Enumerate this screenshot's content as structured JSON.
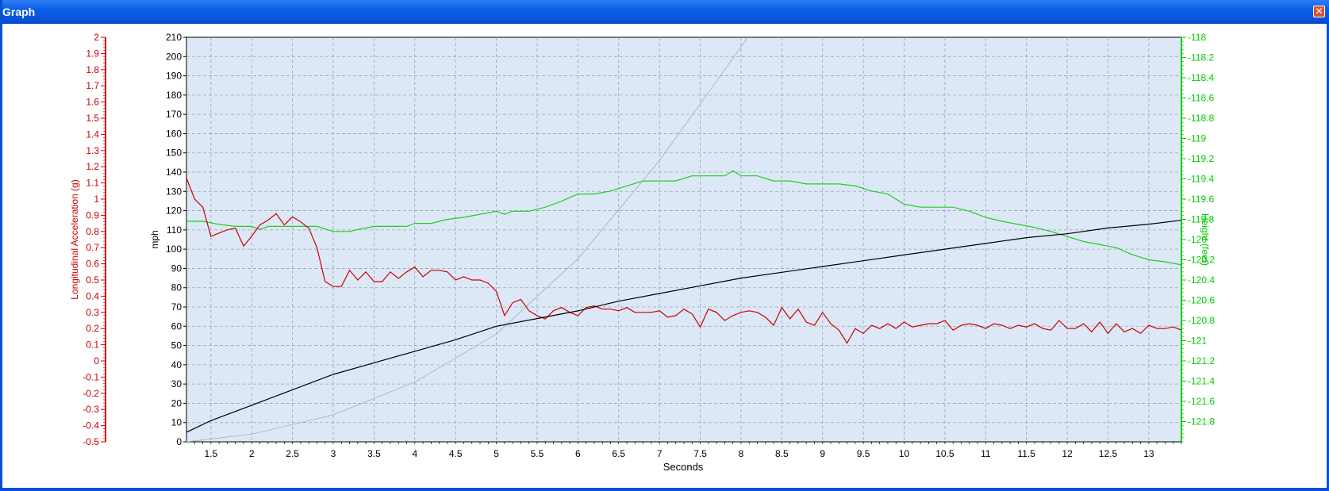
{
  "window": {
    "title": "Graph",
    "close_icon": "close-icon"
  },
  "colors": {
    "plot_bg": "#dde8f6",
    "grid": "#9aa4b2",
    "left_axis": "#cc0000",
    "right_axis": "#00cc00",
    "speed": "#000000",
    "accel": "#cc0000",
    "height": "#22cc22",
    "curve": "#b0b8c8"
  },
  "chart_data": {
    "type": "line",
    "xlabel": "Seconds",
    "ylabel": "mph",
    "left_axis_label": "Longitudinal Acceleration (g)",
    "right_axis_label": "Height (feet)",
    "xlim": [
      1.2,
      13.4
    ],
    "ylim": [
      0,
      210
    ],
    "left_lim": [
      -0.5,
      2
    ],
    "right_lim": [
      -122,
      -118
    ],
    "x_ticks": [
      "1.5",
      "2",
      "2.5",
      "3",
      "3.5",
      "4",
      "4.5",
      "5",
      "5.5",
      "6",
      "6.5",
      "7",
      "7.5",
      "8",
      "8.5",
      "9",
      "9.5",
      "10",
      "10.5",
      "11",
      "11.5",
      "12",
      "12.5",
      "13"
    ],
    "y_ticks": [
      "0",
      "10",
      "20",
      "30",
      "40",
      "50",
      "60",
      "70",
      "80",
      "90",
      "100",
      "110",
      "120",
      "130",
      "140",
      "150",
      "160",
      "170",
      "180",
      "190",
      "200",
      "210"
    ],
    "left_ticks": [
      "-0.5",
      "-0.4",
      "-0.3",
      "-0.2",
      "-0.1",
      "0",
      "0.1",
      "0.2",
      "0.3",
      "0.4",
      "0.5",
      "0.6",
      "0.7",
      "0.8",
      "0.9",
      "1",
      "1.1",
      "1.2",
      "1.3",
      "1.4",
      "1.5",
      "1.6",
      "1.7",
      "1.8",
      "1.9",
      "2"
    ],
    "right_ticks": [
      "-121.8",
      "-121.6",
      "-121.4",
      "-121.2",
      "-121",
      "-120.8",
      "-120.6",
      "-120.4",
      "-120.2",
      "-120",
      "-119.8",
      "-119.6",
      "-119.4",
      "-119.2",
      "-119",
      "-118.8",
      "-118.6",
      "-118.4",
      "-118.2",
      "-118"
    ],
    "series": [
      {
        "axis": "mph",
        "color": "#000000",
        "x": [
          1.2,
          1.5,
          2,
          2.5,
          3,
          3.5,
          4,
          4.5,
          5,
          5.5,
          6,
          6.5,
          7,
          7.5,
          8,
          8.5,
          9,
          9.5,
          10,
          10.5,
          11,
          11.5,
          12,
          12.5,
          13,
          13.4
        ],
        "values": [
          5,
          11,
          19,
          27,
          35,
          41,
          47,
          53,
          60,
          64,
          68,
          73,
          77,
          81,
          85,
          88,
          91,
          94,
          97,
          100,
          103,
          106,
          108,
          111,
          113,
          115
        ]
      },
      {
        "axis": "g",
        "color": "#cc0000",
        "x": [
          1.2,
          1.3,
          1.4,
          1.5,
          1.6,
          1.7,
          1.8,
          1.9,
          2.0,
          2.1,
          2.2,
          2.3,
          2.4,
          2.5,
          2.6,
          2.7,
          2.8,
          2.9,
          3.0,
          3.1,
          3.2,
          3.3,
          3.4,
          3.5,
          3.6,
          3.7,
          3.8,
          3.9,
          4.0,
          4.1,
          4.2,
          4.3,
          4.4,
          4.5,
          4.6,
          4.7,
          4.8,
          4.9,
          5.0,
          5.1,
          5.2,
          5.3,
          5.4,
          5.5,
          5.6,
          5.7,
          5.8,
          5.9,
          6.0,
          6.1,
          6.2,
          6.3,
          6.4,
          6.5,
          6.6,
          6.7,
          6.8,
          6.9,
          7.0,
          7.1,
          7.2,
          7.3,
          7.4,
          7.5,
          7.6,
          7.7,
          7.8,
          7.9,
          8.0,
          8.1,
          8.2,
          8.3,
          8.4,
          8.5,
          8.6,
          8.7,
          8.8,
          8.9,
          9.0,
          9.1,
          9.2,
          9.3,
          9.4,
          9.5,
          9.6,
          9.7,
          9.8,
          9.9,
          10.0,
          10.1,
          10.2,
          10.3,
          10.4,
          10.5,
          10.6,
          10.7,
          10.8,
          10.9,
          11.0,
          11.1,
          11.2,
          11.3,
          11.4,
          11.5,
          11.6,
          11.7,
          11.8,
          11.9,
          12.0,
          12.1,
          12.2,
          12.3,
          12.4,
          12.5,
          12.6,
          12.7,
          12.8,
          12.9,
          13.0,
          13.1,
          13.2,
          13.3,
          13.4
        ],
        "values": [
          1.13,
          1.0,
          0.95,
          0.77,
          0.79,
          0.81,
          0.82,
          0.71,
          0.77,
          0.84,
          0.87,
          0.91,
          0.84,
          0.89,
          0.86,
          0.82,
          0.7,
          0.49,
          0.46,
          0.46,
          0.56,
          0.5,
          0.55,
          0.49,
          0.49,
          0.55,
          0.51,
          0.55,
          0.58,
          0.52,
          0.56,
          0.56,
          0.55,
          0.5,
          0.52,
          0.5,
          0.5,
          0.48,
          0.43,
          0.28,
          0.36,
          0.38,
          0.31,
          0.28,
          0.26,
          0.31,
          0.33,
          0.3,
          0.28,
          0.33,
          0.34,
          0.32,
          0.32,
          0.31,
          0.33,
          0.3,
          0.3,
          0.3,
          0.31,
          0.27,
          0.28,
          0.32,
          0.29,
          0.21,
          0.32,
          0.3,
          0.25,
          0.28,
          0.3,
          0.31,
          0.3,
          0.27,
          0.22,
          0.33,
          0.26,
          0.32,
          0.24,
          0.22,
          0.3,
          0.23,
          0.19,
          0.11,
          0.2,
          0.17,
          0.22,
          0.2,
          0.23,
          0.2,
          0.24,
          0.21,
          0.22,
          0.23,
          0.23,
          0.25,
          0.19,
          0.22,
          0.23,
          0.22,
          0.2,
          0.23,
          0.22,
          0.2,
          0.22,
          0.21,
          0.23,
          0.2,
          0.19,
          0.25,
          0.2,
          0.2,
          0.23,
          0.18,
          0.24,
          0.17,
          0.23,
          0.18,
          0.2,
          0.17,
          0.22,
          0.2,
          0.2,
          0.21,
          0.19
        ],
        "name": ""
      },
      {
        "axis": "feet",
        "color": "#22cc22",
        "x": [
          1.2,
          1.4,
          1.6,
          1.8,
          2.0,
          2.1,
          2.2,
          2.4,
          2.6,
          2.8,
          3.0,
          3.2,
          3.3,
          3.5,
          3.7,
          3.9,
          4.0,
          4.2,
          4.4,
          4.6,
          4.8,
          5.0,
          5.1,
          5.2,
          5.4,
          5.6,
          5.8,
          6.0,
          6.2,
          6.4,
          6.6,
          6.8,
          7.0,
          7.2,
          7.4,
          7.6,
          7.8,
          7.9,
          8.0,
          8.2,
          8.4,
          8.6,
          8.8,
          9.0,
          9.2,
          9.4,
          9.6,
          9.8,
          10.0,
          10.2,
          10.4,
          10.6,
          10.8,
          11.0,
          11.2,
          11.4,
          11.6,
          11.8,
          12.0,
          12.2,
          12.4,
          12.6,
          12.8,
          13.0,
          13.2,
          13.4
        ],
        "values": [
          -119.82,
          -119.82,
          -119.85,
          -119.87,
          -119.87,
          -119.9,
          -119.87,
          -119.87,
          -119.87,
          -119.87,
          -119.92,
          -119.92,
          -119.9,
          -119.87,
          -119.87,
          -119.87,
          -119.84,
          -119.84,
          -119.8,
          -119.78,
          -119.75,
          -119.72,
          -119.75,
          -119.72,
          -119.72,
          -119.68,
          -119.62,
          -119.55,
          -119.55,
          -119.52,
          -119.47,
          -119.42,
          -119.42,
          -119.42,
          -119.37,
          -119.37,
          -119.37,
          -119.32,
          -119.37,
          -119.37,
          -119.42,
          -119.42,
          -119.45,
          -119.45,
          -119.45,
          -119.47,
          -119.52,
          -119.55,
          -119.65,
          -119.68,
          -119.68,
          -119.68,
          -119.72,
          -119.78,
          -119.82,
          -119.85,
          -119.88,
          -119.92,
          -119.97,
          -120.02,
          -120.05,
          -120.08,
          -120.15,
          -120.2,
          -120.22,
          -120.25
        ],
        "name": ""
      },
      {
        "axis": "unlabeled",
        "color": "#b0b8c8",
        "x": [
          1.2,
          2,
          3,
          4,
          5,
          6,
          7,
          8,
          8.4
        ],
        "values": [
          0,
          4,
          14,
          31,
          56,
          95,
          146,
          205,
          230
        ],
        "name": ""
      }
    ]
  }
}
